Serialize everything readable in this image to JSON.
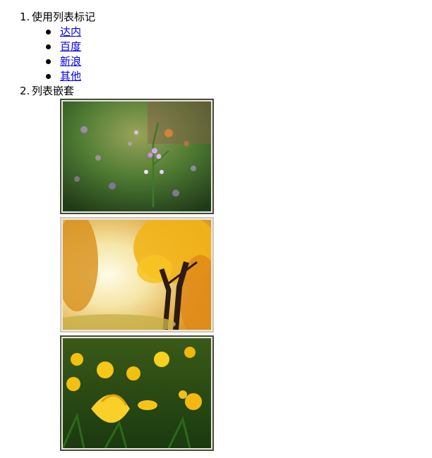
{
  "sections": [
    {
      "number": "1.",
      "title": "使用列表标记",
      "links": [
        "达内",
        "百度",
        "新浪",
        "其他"
      ]
    },
    {
      "number": "2.",
      "title": "列表嵌套",
      "images": [
        {
          "subject": "purple wildflowers"
        },
        {
          "subject": "autumn yellow tree"
        },
        {
          "subject": "yellow lilies"
        }
      ]
    }
  ]
}
